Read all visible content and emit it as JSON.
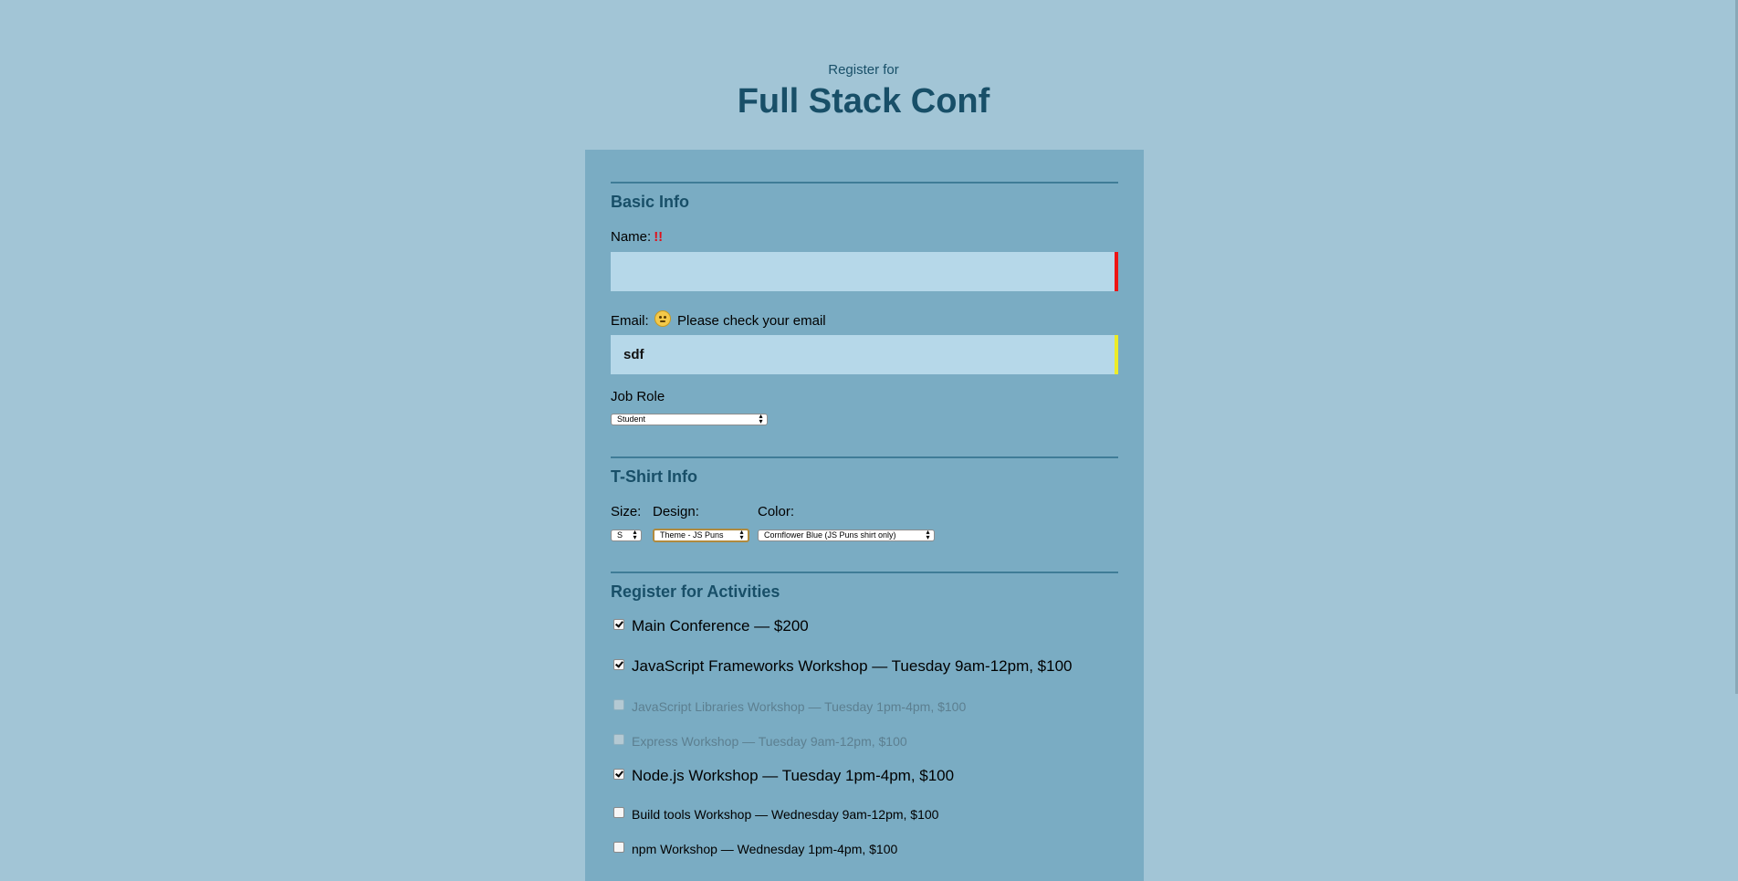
{
  "header": {
    "subtitle": "Register for",
    "title": "Full Stack Conf"
  },
  "basic_info": {
    "legend": "Basic Info",
    "name_label": "Name:",
    "name_error_mark": "!!",
    "name_value": "",
    "email_label": "Email:",
    "email_icon": "face-with-rolling-eyes-icon",
    "email_hint": "Please check your email",
    "email_value": "sdf",
    "job_role_label": "Job Role",
    "job_role_value": "Student"
  },
  "tshirt_info": {
    "legend": "T-Shirt Info",
    "size_label": "Size:",
    "size_value": "S",
    "design_label": "Design:",
    "design_value": "Theme - JS Puns",
    "color_label": "Color:",
    "color_value": "Cornflower Blue (JS Puns shirt only)"
  },
  "activities": {
    "legend": "Register for Activities",
    "items": [
      {
        "label": "Main Conference — $200",
        "checked": true,
        "disabled": false
      },
      {
        "label": "JavaScript Frameworks Workshop — Tuesday 9am-12pm, $100",
        "checked": true,
        "disabled": false
      },
      {
        "label": "JavaScript Libraries Workshop — Tuesday 1pm-4pm, $100",
        "checked": false,
        "disabled": true
      },
      {
        "label": "Express Workshop — Tuesday 9am-12pm, $100",
        "checked": false,
        "disabled": true
      },
      {
        "label": "Node.js Workshop — Tuesday 1pm-4pm, $100",
        "checked": true,
        "disabled": false
      },
      {
        "label": "Build tools Workshop — Wednesday 9am-12pm, $100",
        "checked": false,
        "disabled": false
      },
      {
        "label": "npm Workshop — Wednesday 1pm-4pm, $100",
        "checked": false,
        "disabled": false
      }
    ]
  },
  "colors": {
    "page_background": "#a2c5d6",
    "form_background": "#7aacc3",
    "heading": "#184f68",
    "input_background": "#b6d8e9",
    "error_bar": "#ee1414",
    "warning_bar": "#ecec28"
  }
}
